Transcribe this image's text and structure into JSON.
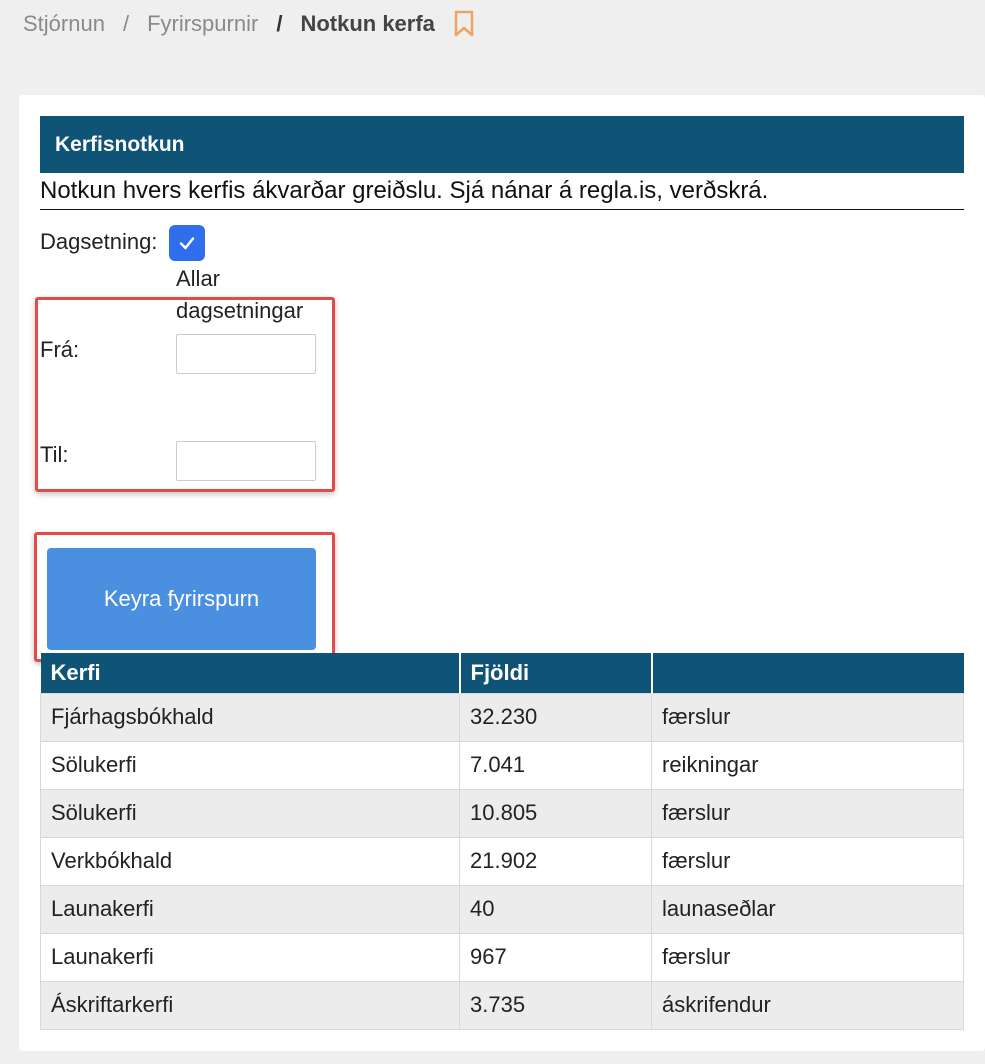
{
  "breadcrumb": {
    "items": [
      "Stjórnun",
      "Fyrirspurnir"
    ],
    "separator": "/",
    "current": "Notkun kerfa"
  },
  "panel": {
    "title": "Kerfisnotkun",
    "description": "Notkun hvers kerfis ákvarðar greiðslu. Sjá nánar á regla.is, verðskrá."
  },
  "form": {
    "date_label": "Dagsetning:",
    "all_dates_label": "Allar dagsetningar",
    "all_dates_checked": true,
    "from_label": "Frá:",
    "from_value": "",
    "to_label": "Til:",
    "to_value": "",
    "run_button": "Keyra fyrirspurn"
  },
  "table": {
    "headers": [
      "Kerfi",
      "Fjöldi",
      ""
    ],
    "rows": [
      [
        "Fjárhagsbókhald",
        "32.230",
        "færslur"
      ],
      [
        "Sölukerfi",
        "7.041",
        "reikningar"
      ],
      [
        "Sölukerfi",
        "10.805",
        "færslur"
      ],
      [
        "Verkbókhald",
        "21.902",
        "færslur"
      ],
      [
        "Launakerfi",
        "40",
        "launaseðlar"
      ],
      [
        "Launakerfi",
        "967",
        "færslur"
      ],
      [
        "Áskriftarkerfi",
        "3.735",
        "áskrifendur"
      ]
    ]
  },
  "colors": {
    "header_bg": "#0f5376",
    "button_bg": "#4a8fe0",
    "checkbox_bg": "#2f6fed",
    "highlight": "#e34b4b",
    "bookmark": "#f0a35e"
  },
  "icons": {
    "bookmark": "bookmark-icon",
    "check": "check-icon"
  }
}
